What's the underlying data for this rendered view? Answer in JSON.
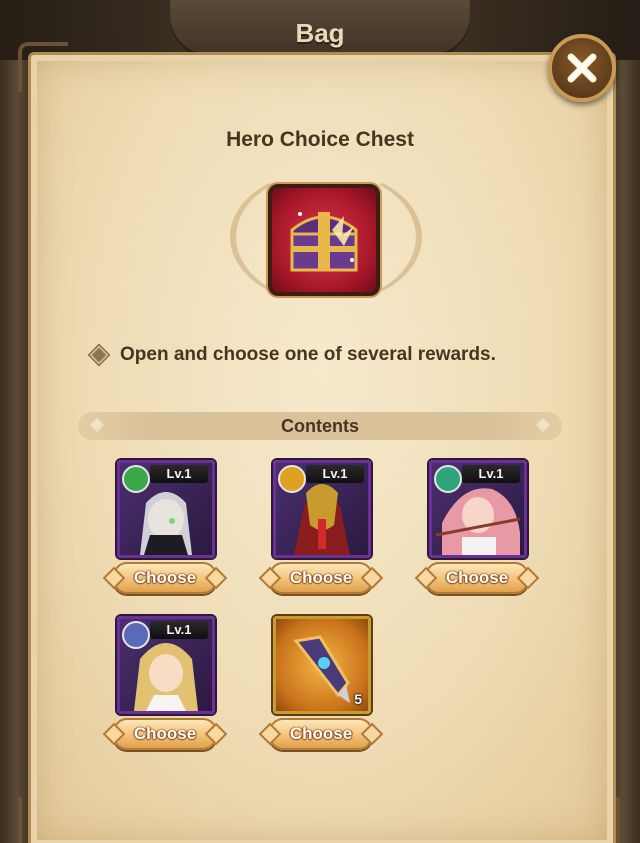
{
  "window": {
    "title": "Bag"
  },
  "close_button": {
    "icon": "close-icon"
  },
  "chest": {
    "title": "Hero Choice Chest",
    "icon": "treasure-chest-icon",
    "description": "Open and choose one of several rewards."
  },
  "contents": {
    "header": "Contents",
    "items": [
      {
        "type": "hero",
        "level": "Lv.1",
        "faction": "green-eye",
        "faction_color": "#3aa84a",
        "choose_label": "Choose"
      },
      {
        "type": "hero",
        "level": "Lv.1",
        "faction": "gold-sun",
        "faction_color": "#e0a020",
        "choose_label": "Choose"
      },
      {
        "type": "hero",
        "level": "Lv.1",
        "faction": "green-leaf",
        "faction_color": "#2fa37a",
        "choose_label": "Choose"
      },
      {
        "type": "hero",
        "level": "Lv.1",
        "faction": "silver-star",
        "faction_color": "#5a6ab8",
        "choose_label": "Choose"
      },
      {
        "type": "item",
        "count": "5",
        "icon": "gauntlet-icon",
        "choose_label": "Choose"
      }
    ]
  },
  "colors": {
    "parchment": "#efdcb5",
    "hero_frame": "#6c2f9a",
    "button_gold": "#f3c27a",
    "chest_red": "#a31628"
  }
}
